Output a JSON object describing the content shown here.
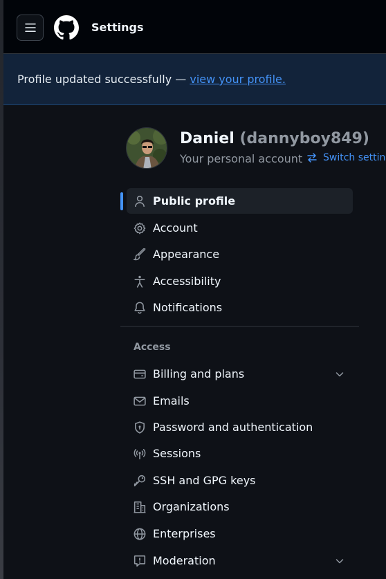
{
  "header": {
    "title": "Settings",
    "menu_icon": "hamburger-icon",
    "logo_icon": "github-mark-icon"
  },
  "flash": {
    "text": "Profile updated successfully — ",
    "link_text": "view your profile."
  },
  "account": {
    "display_name": "Daniel",
    "handle": "(dannyboy849)",
    "subtitle": "Your personal account",
    "switch_label": "Switch setting"
  },
  "nav": {
    "items": [
      {
        "label": "Public profile",
        "icon": "person-icon",
        "active": true
      },
      {
        "label": "Account",
        "icon": "gear-icon"
      },
      {
        "label": "Appearance",
        "icon": "paintbrush-icon"
      },
      {
        "label": "Accessibility",
        "icon": "accessibility-icon"
      },
      {
        "label": "Notifications",
        "icon": "bell-icon"
      }
    ],
    "access_section": {
      "label": "Access",
      "items": [
        {
          "label": "Billing and plans",
          "icon": "credit-card-icon",
          "expandable": true
        },
        {
          "label": "Emails",
          "icon": "mail-icon"
        },
        {
          "label": "Password and authentication",
          "icon": "shield-lock-icon"
        },
        {
          "label": "Sessions",
          "icon": "broadcast-icon"
        },
        {
          "label": "SSH and GPG keys",
          "icon": "key-icon"
        },
        {
          "label": "Organizations",
          "icon": "organization-icon"
        },
        {
          "label": "Enterprises",
          "icon": "globe-icon"
        },
        {
          "label": "Moderation",
          "icon": "report-icon",
          "expandable": true
        }
      ]
    }
  },
  "colors": {
    "accent": "#4493f8",
    "background": "#0e1117",
    "header_bg": "#010409",
    "flash_bg": "#12233a",
    "text": "#f0f6fc",
    "muted": "#9198a1"
  }
}
